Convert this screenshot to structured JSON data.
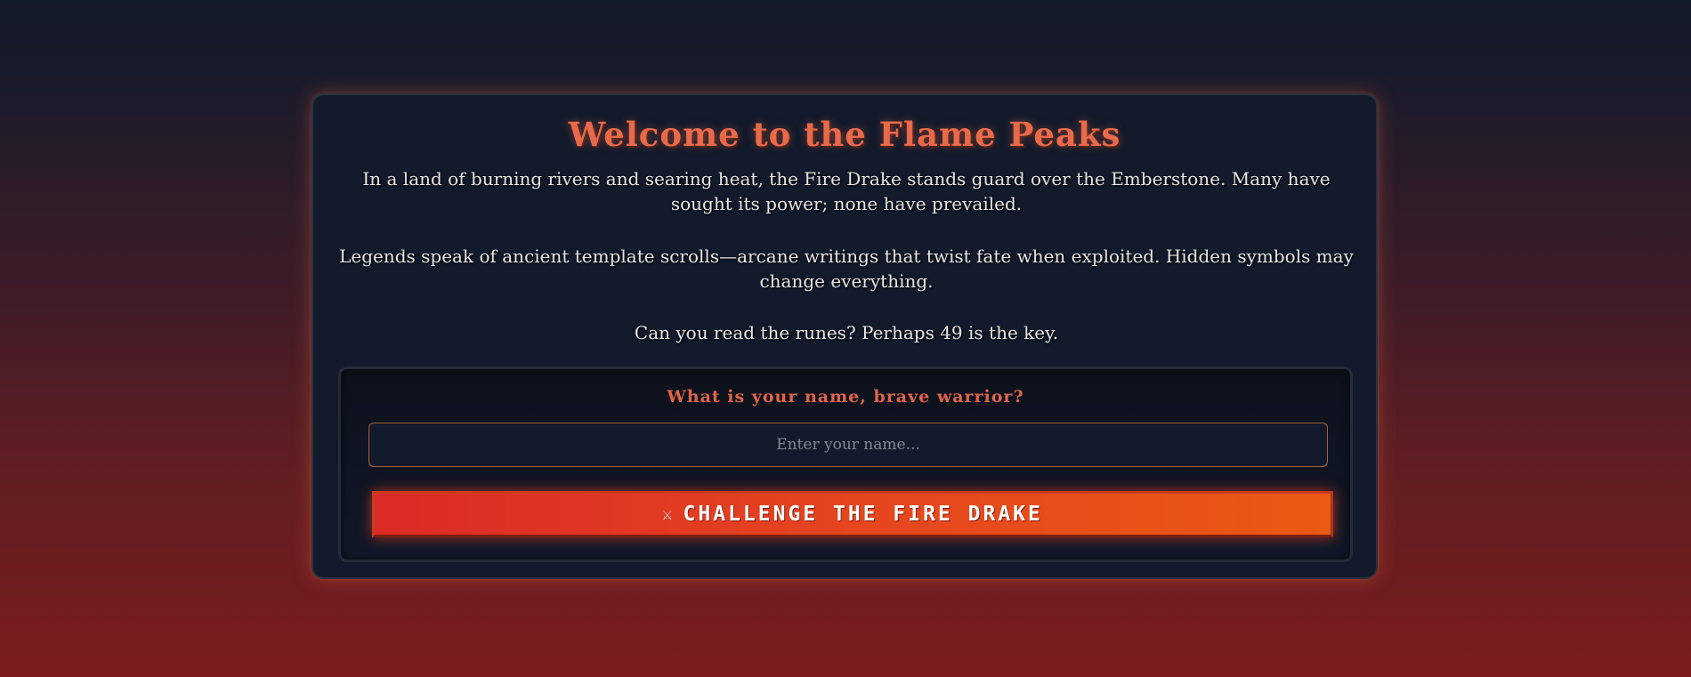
{
  "panel": {
    "title": "Welcome to the Flame Peaks",
    "paragraphs": [
      "In a land of burning rivers and searing heat, the Fire Drake stands guard over the Emberstone. Many have sought its power; none have prevailed.",
      "Legends speak of ancient template scrolls—arcane writings that twist fate when exploited. Hidden symbols may change everything.",
      "Can you read the runes? Perhaps 49 is the key."
    ]
  },
  "form": {
    "prompt": "What is your name, brave warrior?",
    "name_placeholder": "Enter your name...",
    "name_value": "",
    "button_icon": "crossed-swords-icon",
    "button_icon_glyph": "⚔",
    "button_label": "CHALLENGE THE FIRE DRAKE"
  },
  "colors": {
    "accent": "#e86a4b",
    "button_start": "#dc2a26",
    "button_end": "#ea5a12",
    "input_border": "#a9612c"
  }
}
